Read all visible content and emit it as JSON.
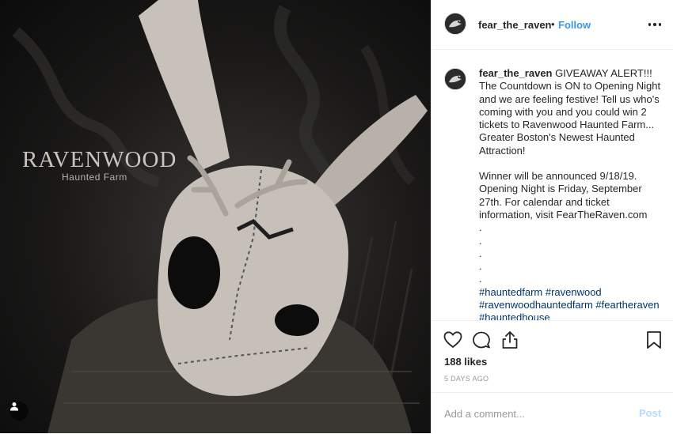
{
  "photo": {
    "watermark_title": "RAVENWOOD",
    "watermark_subtitle": "Haunted Farm",
    "user_tag_icon": "person-icon"
  },
  "header": {
    "username": "fear_the_raven",
    "separator": "•",
    "follow_label": "Follow",
    "more_icon": "more-options-icon"
  },
  "caption": {
    "username": "fear_the_raven",
    "text": "GIVEAWAY ALERT!!! The Countdown is ON to Opening Night and we are feeling festive! Tell us who's coming with you and you could win 2 tickets to Ravenwood Haunted Farm... Greater Boston's Newest Haunted Attraction!",
    "text2": "Winner will be announced 9/18/19. Opening Night is Friday, September 27th. For calendar and ticket information, visit FearTheRaven.com",
    "dots": ".\n.\n.\n.\n.",
    "hashtags": "#hauntedfarm #ravenwood #ravenwoodhauntedfarm #feartheraven #hauntedhouse"
  },
  "actions": {
    "like_icon": "heart-icon",
    "comment_icon": "comment-icon",
    "share_icon": "share-icon",
    "save_icon": "bookmark-icon",
    "likes": "188 likes",
    "date": "5 DAYS AGO"
  },
  "comment_box": {
    "placeholder": "Add a comment...",
    "post_label": "Post"
  },
  "colors": {
    "link_blue": "#3897f0",
    "hashtag_blue": "#003569",
    "post_disabled": "#b3dbff"
  }
}
